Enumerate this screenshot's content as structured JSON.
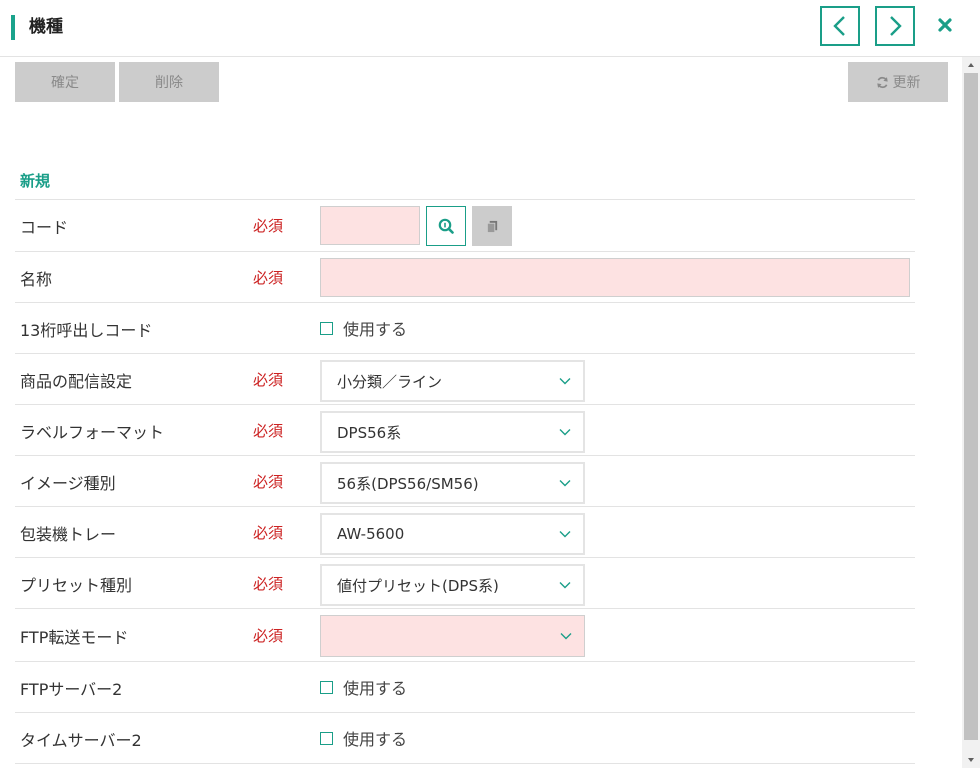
{
  "header": {
    "title": "機種",
    "prev_icon": "chevron-left-icon",
    "next_icon": "chevron-right-icon",
    "close_icon": "close-icon",
    "accent_color": "#1aa38c"
  },
  "toolbar": {
    "confirm_label": "確定",
    "delete_label": "削除",
    "refresh_label": "更新",
    "refresh_icon": "refresh-icon"
  },
  "section": {
    "title": "新規"
  },
  "required_text": "必須",
  "fields": {
    "code": {
      "label": "コード",
      "value": "",
      "search_icon": "search-icon",
      "copy_icon": "copy-icon"
    },
    "name": {
      "label": "名称",
      "value": ""
    },
    "call_code13": {
      "label": "13桁呼出しコード",
      "checkbox_label": "使用する"
    },
    "delivery_setting": {
      "label": "商品の配信設定",
      "selected": "小分類／ライン"
    },
    "label_format": {
      "label": "ラベルフォーマット",
      "selected": "DPS56系"
    },
    "image_type": {
      "label": "イメージ種別",
      "selected": "56系(DPS56/SM56)"
    },
    "wrapper_tray": {
      "label": "包装機トレー",
      "selected": "AW-5600"
    },
    "preset_type": {
      "label": "プリセット種別",
      "selected": "値付プリセット(DPS系)"
    },
    "ftp_mode": {
      "label": "FTP転送モード",
      "selected": ""
    },
    "ftp_server2": {
      "label": "FTPサーバー2",
      "checkbox_label": "使用する"
    },
    "time_server2": {
      "label": "タイムサーバー2",
      "checkbox_label": "使用する"
    }
  },
  "colors": {
    "required_red": "#cc2222",
    "required_bg": "#fde2e2",
    "disabled_btn": "#cccccc"
  }
}
